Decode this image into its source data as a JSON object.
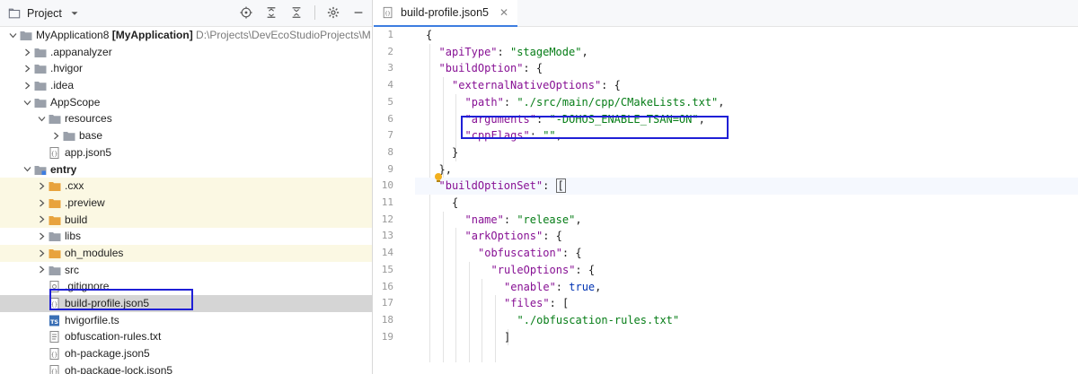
{
  "project_panel": {
    "title": "Project",
    "tools": [
      "locate-icon",
      "expand-all-icon",
      "collapse-all-icon",
      "gear-icon",
      "hide-icon"
    ],
    "tree": [
      {
        "label": "MyApplication8",
        "bold_suffix": "[MyApplication]",
        "path": "D:\\Projects\\DevEcoStudioProjects\\M",
        "depth": 0,
        "expanded": true,
        "icon": "folder-icon"
      },
      {
        "label": ".appanalyzer",
        "depth": 1,
        "expanded": false,
        "icon": "folder-icon"
      },
      {
        "label": ".hvigor",
        "depth": 1,
        "expanded": false,
        "icon": "folder-icon"
      },
      {
        "label": ".idea",
        "depth": 1,
        "expanded": false,
        "icon": "folder-icon"
      },
      {
        "label": "AppScope",
        "depth": 1,
        "expanded": true,
        "icon": "folder-icon"
      },
      {
        "label": "resources",
        "depth": 2,
        "expanded": true,
        "icon": "folder-icon"
      },
      {
        "label": "base",
        "depth": 3,
        "expanded": false,
        "icon": "folder-icon"
      },
      {
        "label": "app.json5",
        "depth": 2,
        "icon": "json-file-icon"
      },
      {
        "label": "entry",
        "depth": 1,
        "expanded": true,
        "icon": "module-folder-icon",
        "bold": true
      },
      {
        "label": ".cxx",
        "depth": 2,
        "expanded": false,
        "icon": "orange-folder-icon",
        "excluded": true
      },
      {
        "label": ".preview",
        "depth": 2,
        "expanded": false,
        "icon": "orange-folder-icon",
        "excluded": true
      },
      {
        "label": "build",
        "depth": 2,
        "expanded": false,
        "icon": "orange-folder-icon",
        "excluded": true
      },
      {
        "label": "libs",
        "depth": 2,
        "expanded": false,
        "icon": "folder-icon"
      },
      {
        "label": "oh_modules",
        "depth": 2,
        "expanded": false,
        "icon": "orange-folder-icon",
        "excluded": true
      },
      {
        "label": "src",
        "depth": 2,
        "expanded": false,
        "icon": "folder-icon"
      },
      {
        "label": ".gitignore",
        "depth": 2,
        "icon": "gitignore-file-icon"
      },
      {
        "label": "build-profile.json5",
        "depth": 2,
        "icon": "json-file-icon",
        "selected": true
      },
      {
        "label": "hvigorfile.ts",
        "depth": 2,
        "icon": "ts-file-icon"
      },
      {
        "label": "obfuscation-rules.txt",
        "depth": 2,
        "icon": "text-file-icon"
      },
      {
        "label": "oh-package.json5",
        "depth": 2,
        "icon": "json-file-icon"
      },
      {
        "label": "oh-package-lock.json5",
        "depth": 2,
        "icon": "json-file-icon"
      }
    ]
  },
  "editor": {
    "tab_label": "build-profile.json5",
    "line_numbers": [
      "1",
      "2",
      "3",
      "4",
      "5",
      "6",
      "7",
      "8",
      "9",
      "10",
      "11",
      "12",
      "13",
      "14",
      "15",
      "16",
      "17",
      "18",
      "19"
    ],
    "lines": [
      {
        "indent": 0,
        "tokens": [
          {
            "t": "p",
            "v": "{"
          }
        ]
      },
      {
        "indent": 1,
        "tokens": [
          {
            "t": "k",
            "v": "\"apiType\""
          },
          {
            "t": "p",
            "v": ": "
          },
          {
            "t": "s",
            "v": "\"stageMode\""
          },
          {
            "t": "p",
            "v": ","
          }
        ]
      },
      {
        "indent": 1,
        "tokens": [
          {
            "t": "k",
            "v": "\"buildOption\""
          },
          {
            "t": "p",
            "v": ": {"
          }
        ]
      },
      {
        "indent": 2,
        "tokens": [
          {
            "t": "k",
            "v": "\"externalNativeOptions\""
          },
          {
            "t": "p",
            "v": ": {"
          }
        ]
      },
      {
        "indent": 3,
        "tokens": [
          {
            "t": "k",
            "v": "\"path\""
          },
          {
            "t": "p",
            "v": ": "
          },
          {
            "t": "s",
            "v": "\"./src/main/cpp/CMakeLists.txt\""
          },
          {
            "t": "p",
            "v": ","
          }
        ]
      },
      {
        "indent": 3,
        "tokens": [
          {
            "t": "k",
            "v": "\"arguments\""
          },
          {
            "t": "p",
            "v": ": "
          },
          {
            "t": "s",
            "v": "\"-DOHOS_ENABLE_TSAN=ON\""
          },
          {
            "t": "p",
            "v": ","
          }
        ]
      },
      {
        "indent": 3,
        "tokens": [
          {
            "t": "k",
            "v": "\"cppFlags\""
          },
          {
            "t": "p",
            "v": ": "
          },
          {
            "t": "s",
            "v": "\"\""
          },
          {
            "t": "p",
            "v": ","
          }
        ]
      },
      {
        "indent": 2,
        "tokens": [
          {
            "t": "p",
            "v": "}"
          }
        ]
      },
      {
        "indent": 1,
        "tokens": [
          {
            "t": "p",
            "v": "},"
          }
        ]
      },
      {
        "indent": 1,
        "tokens": [
          {
            "t": "k",
            "v": "\"buildOptionSet\""
          },
          {
            "t": "p",
            "v": ": "
          },
          {
            "t": "caret",
            "v": "["
          }
        ]
      },
      {
        "indent": 2,
        "tokens": [
          {
            "t": "p",
            "v": "{"
          }
        ]
      },
      {
        "indent": 3,
        "tokens": [
          {
            "t": "k",
            "v": "\"name\""
          },
          {
            "t": "p",
            "v": ": "
          },
          {
            "t": "s",
            "v": "\"release\""
          },
          {
            "t": "p",
            "v": ","
          }
        ]
      },
      {
        "indent": 3,
        "tokens": [
          {
            "t": "k",
            "v": "\"arkOptions\""
          },
          {
            "t": "p",
            "v": ": {"
          }
        ]
      },
      {
        "indent": 4,
        "tokens": [
          {
            "t": "k",
            "v": "\"obfuscation\""
          },
          {
            "t": "p",
            "v": ": {"
          }
        ]
      },
      {
        "indent": 5,
        "tokens": [
          {
            "t": "k",
            "v": "\"ruleOptions\""
          },
          {
            "t": "p",
            "v": ": {"
          }
        ]
      },
      {
        "indent": 6,
        "tokens": [
          {
            "t": "k",
            "v": "\"enable\""
          },
          {
            "t": "p",
            "v": ": "
          },
          {
            "t": "kw",
            "v": "true"
          },
          {
            "t": "p",
            "v": ","
          }
        ]
      },
      {
        "indent": 6,
        "tokens": [
          {
            "t": "k",
            "v": "\"files\""
          },
          {
            "t": "p",
            "v": ": ["
          }
        ]
      },
      {
        "indent": 7,
        "tokens": [
          {
            "t": "s",
            "v": "\"./obfuscation-rules.txt\""
          }
        ]
      },
      {
        "indent": 6,
        "tokens": [
          {
            "t": "p",
            "v": "]"
          }
        ]
      }
    ],
    "current_line": 10
  },
  "colors": {
    "string": "#067d17",
    "key": "#871094",
    "keyword": "#0033b3",
    "highlight_box": "#1f1fd6",
    "excluded_row": "#fbf8e3",
    "selected_row": "#d5d5d5",
    "excluded_folder": "#e8a33d"
  }
}
